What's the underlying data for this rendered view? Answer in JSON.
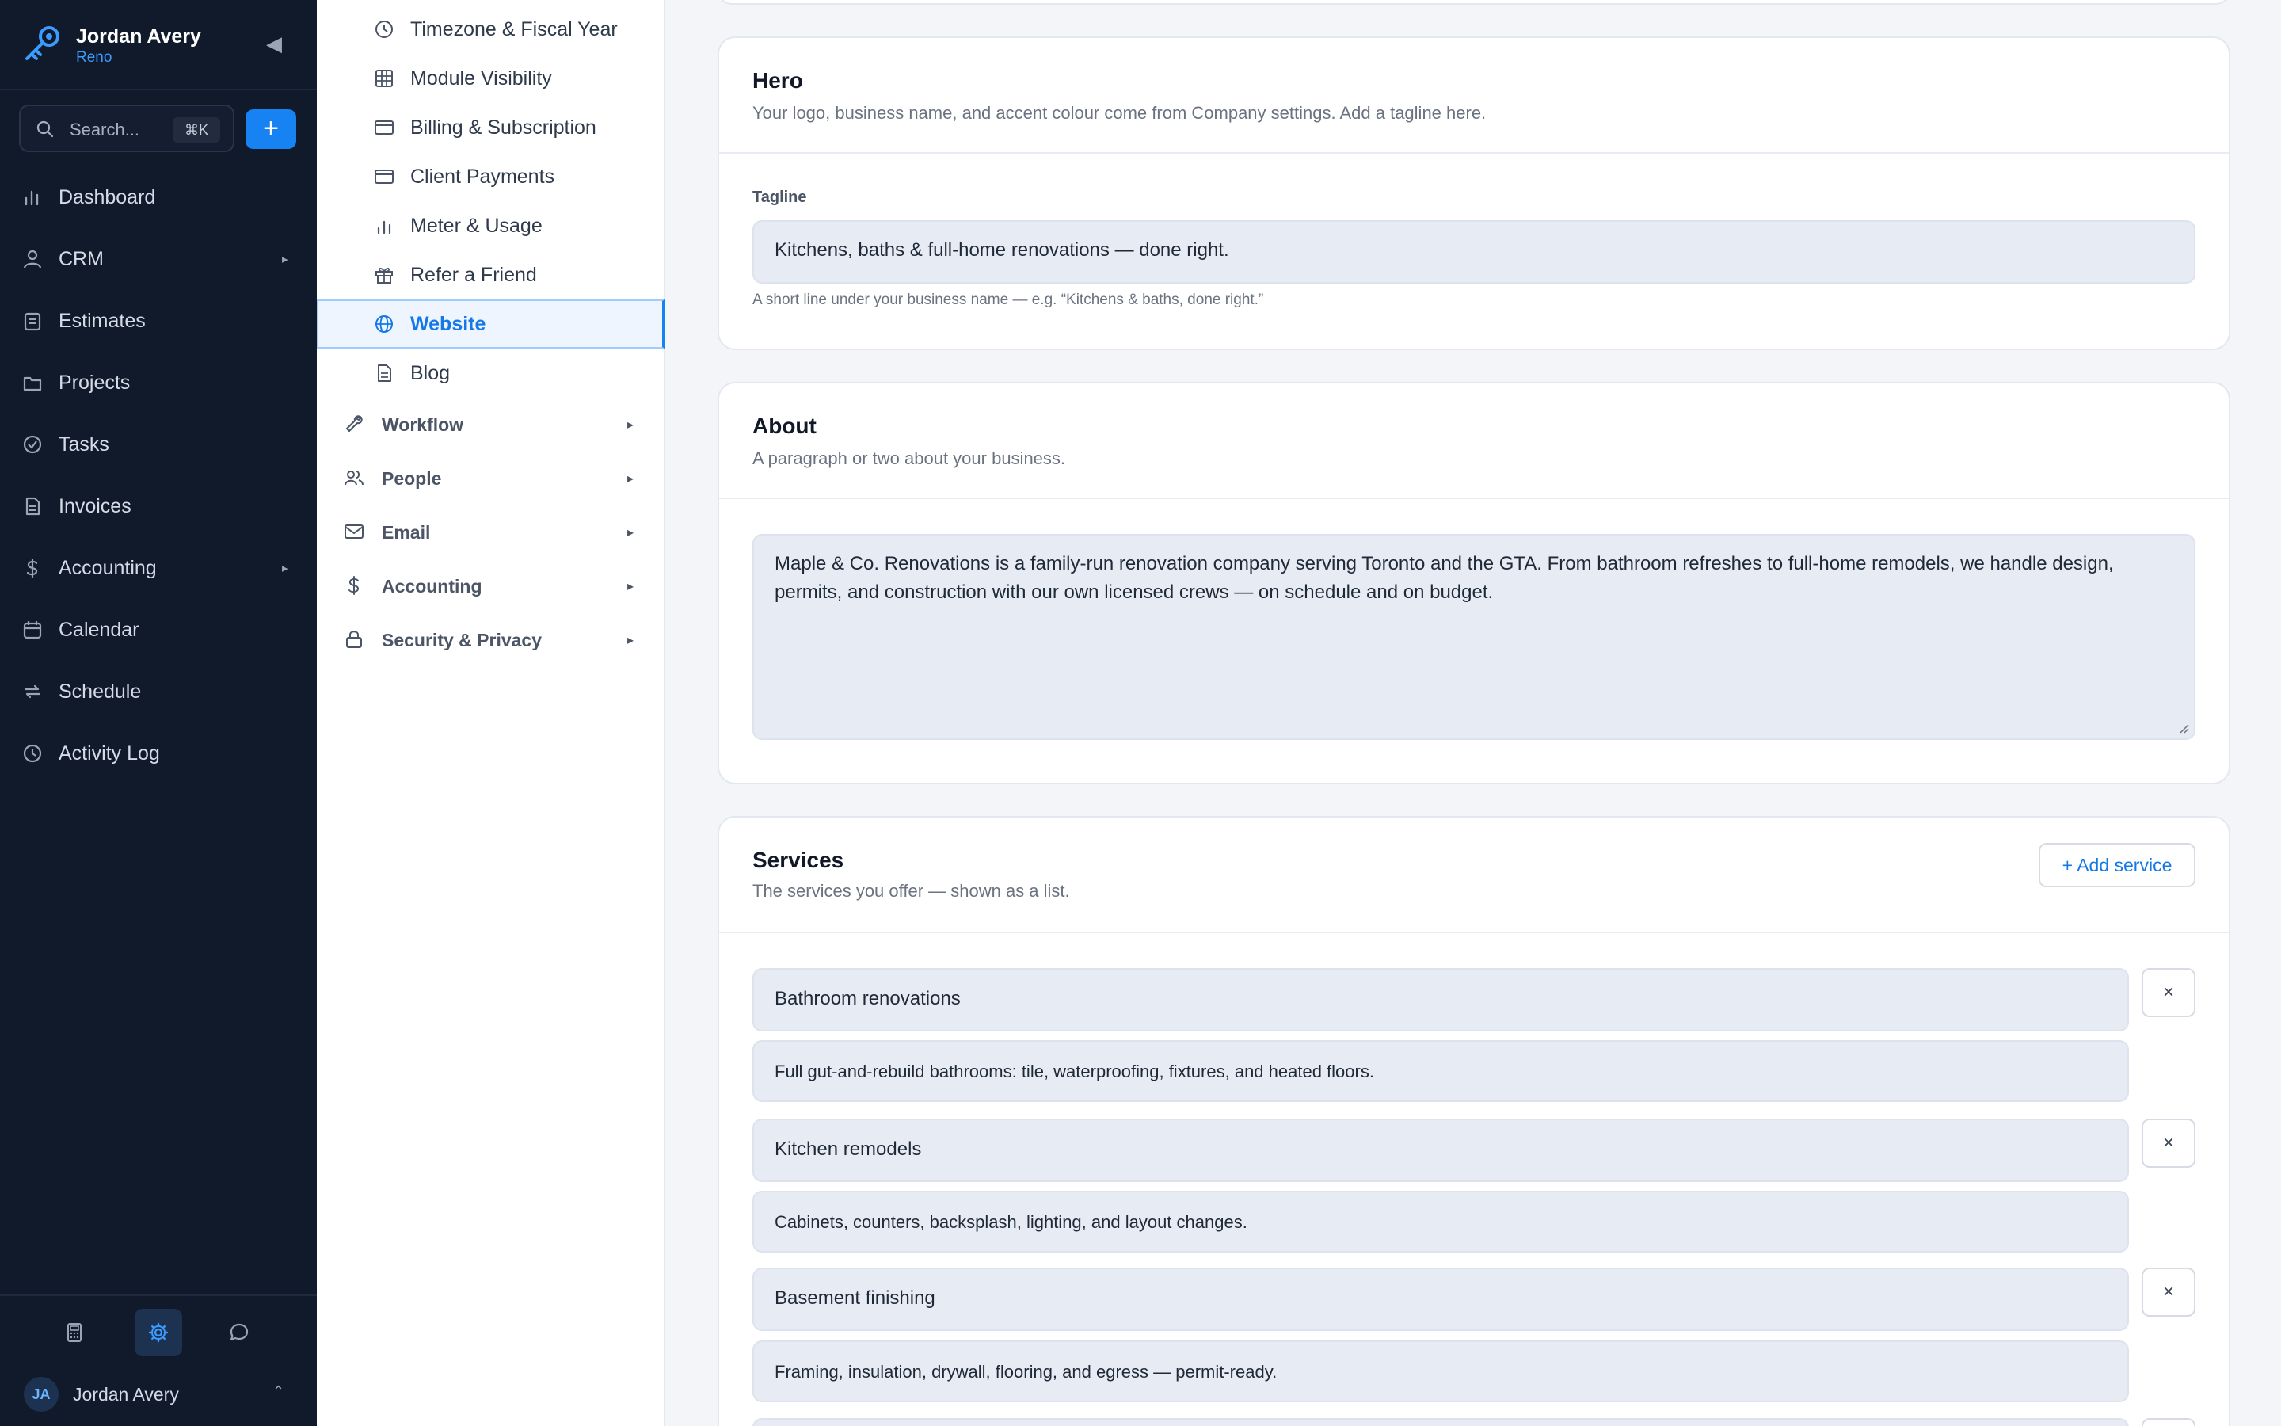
{
  "app": {
    "user_name": "Jordan Avery",
    "workspace": "Reno",
    "collapse_glyph": "◀",
    "search_placeholder": "Search...",
    "search_shortcut": "⌘K",
    "add_glyph": "+",
    "accent": "#1783f2"
  },
  "nav": [
    {
      "label": "Dashboard",
      "icon": "bar-chart-icon",
      "caret": ""
    },
    {
      "label": "CRM",
      "icon": "person-icon",
      "caret": "▸"
    },
    {
      "label": "Estimates",
      "icon": "clipboard-icon",
      "caret": ""
    },
    {
      "label": "Projects",
      "icon": "folder-icon",
      "caret": ""
    },
    {
      "label": "Tasks",
      "icon": "check-circle-icon",
      "caret": ""
    },
    {
      "label": "Invoices",
      "icon": "document-icon",
      "caret": ""
    },
    {
      "label": "Accounting",
      "icon": "dollar-icon",
      "caret": "▸"
    },
    {
      "label": "Calendar",
      "icon": "calendar-icon",
      "caret": ""
    },
    {
      "label": "Schedule",
      "icon": "repeat-icon",
      "caret": ""
    },
    {
      "label": "Activity Log",
      "icon": "clock-icon",
      "caret": ""
    }
  ],
  "footer": {
    "avatar_initials": "JA",
    "user_name": "Jordan Avery",
    "caret": "⌃"
  },
  "subnav": {
    "items": [
      {
        "label": "Timezone & Fiscal Year",
        "icon": "clock-icon",
        "active": false
      },
      {
        "label": "Module Visibility",
        "icon": "grid-icon",
        "active": false
      },
      {
        "label": "Billing & Subscription",
        "icon": "credit-card-icon",
        "active": false
      },
      {
        "label": "Client Payments",
        "icon": "credit-card-icon",
        "active": false
      },
      {
        "label": "Meter & Usage",
        "icon": "bar-chart-icon",
        "active": false
      },
      {
        "label": "Refer a Friend",
        "icon": "gift-icon",
        "active": false
      },
      {
        "label": "Website",
        "icon": "globe-icon",
        "active": true
      },
      {
        "label": "Blog",
        "icon": "document-icon",
        "active": false
      }
    ],
    "groups": [
      {
        "label": "Workflow",
        "icon": "wrench-icon",
        "caret": "▸"
      },
      {
        "label": "People",
        "icon": "people-icon",
        "caret": "▸"
      },
      {
        "label": "Email",
        "icon": "mail-icon",
        "caret": "▸"
      },
      {
        "label": "Accounting",
        "icon": "dollar-icon",
        "caret": "▸"
      },
      {
        "label": "Security & Privacy",
        "icon": "lock-icon",
        "caret": "▸"
      }
    ]
  },
  "hero": {
    "title": "Hero",
    "description": "Your logo, business name, and accent colour come from Company settings. Add a tagline here.",
    "tagline_label": "Tagline",
    "tagline_value": "Kitchens, baths & full-home renovations — done right.",
    "tagline_hint": "A short line under your business name — e.g. “Kitchens & baths, done right.”"
  },
  "about": {
    "title": "About",
    "description": "A paragraph or two about your business.",
    "value": "Maple & Co. Renovations is a family-run renovation company serving Toronto and the GTA. From bathroom refreshes to full-home remodels, we handle design, permits, and construction with our own licensed crews — on schedule and on budget."
  },
  "services": {
    "title": "Services",
    "description": "The services you offer — shown as a list.",
    "add_label": "+ Add service",
    "remove_glyph": "×",
    "items": [
      {
        "name": "Bathroom renovations",
        "description": "Full gut-and-rebuild bathrooms: tile, waterproofing, fixtures, and heated floors."
      },
      {
        "name": "Kitchen remodels",
        "description": "Cabinets, counters, backsplash, lighting, and layout changes."
      },
      {
        "name": "Basement finishing",
        "description": "Framing, insulation, drywall, flooring, and egress — permit-ready."
      }
    ]
  }
}
